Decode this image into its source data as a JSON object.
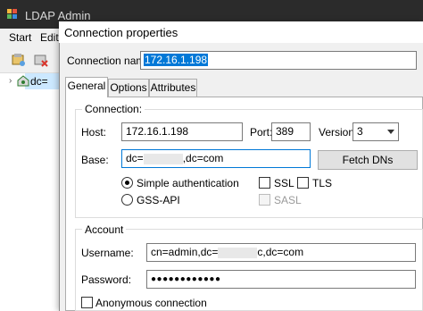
{
  "background_window": {
    "title": "LDAP Admin",
    "menu": [
      "Start",
      "Edit"
    ],
    "tree_item": "dc="
  },
  "dialog": {
    "title": "Connection properties",
    "connection_name_label": "Connection name:",
    "connection_name_value": "172.16.1.198",
    "tabs": [
      "General",
      "Options",
      "Attributes"
    ],
    "connection_group": {
      "label": "Connection:",
      "host_label": "Host:",
      "host_value": "172.16.1.198",
      "port_label": "Port:",
      "port_value": "389",
      "version_label": "Version:",
      "version_value": "3",
      "base_label": "Base:",
      "base_prefix": "dc=",
      "base_suffix": ",dc=com",
      "fetch_dns_button": "Fetch DNs",
      "simple_auth_label": "Simple authentication",
      "gss_api_label": "GSS-API",
      "ssl_label": "SSL",
      "tls_label": "TLS",
      "sasl_label": "SASL"
    },
    "account_group": {
      "label": "Account",
      "username_label": "Username:",
      "username_prefix": "cn=admin,dc=",
      "username_suffix": "c,dc=com",
      "password_label": "Password:",
      "password_value": "●●●●●●●●●●●●",
      "anonymous_label": "Anonymous connection"
    }
  },
  "colors": {
    "selection": "#0078d7",
    "tree_selection": "#cce8ff",
    "titlebar_dark": "#2b2b2b"
  }
}
